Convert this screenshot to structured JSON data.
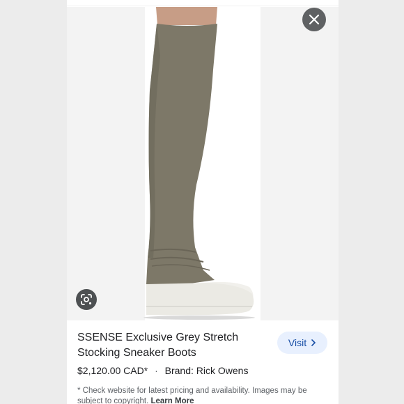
{
  "product": {
    "title": "SSENSE Exclusive Grey Stretch Stocking Sneaker Boots",
    "price": "$2,120.00 CAD*",
    "separator": "·",
    "brand": "Brand: Rick Owens",
    "disclaimer": "* Check website for latest pricing and availability. Images may be subject to copyright.",
    "learn_more": "Learn More"
  },
  "actions": {
    "visit_label": "Visit"
  },
  "icons": {
    "close": "close-icon",
    "lens": "google-lens-icon",
    "visit_arrow": "chevron-right-icon"
  },
  "colors": {
    "boot": "#7d7868",
    "sole": "#efeee9",
    "visit_bg": "#e8f0fe",
    "visit_text": "#174ea6"
  }
}
